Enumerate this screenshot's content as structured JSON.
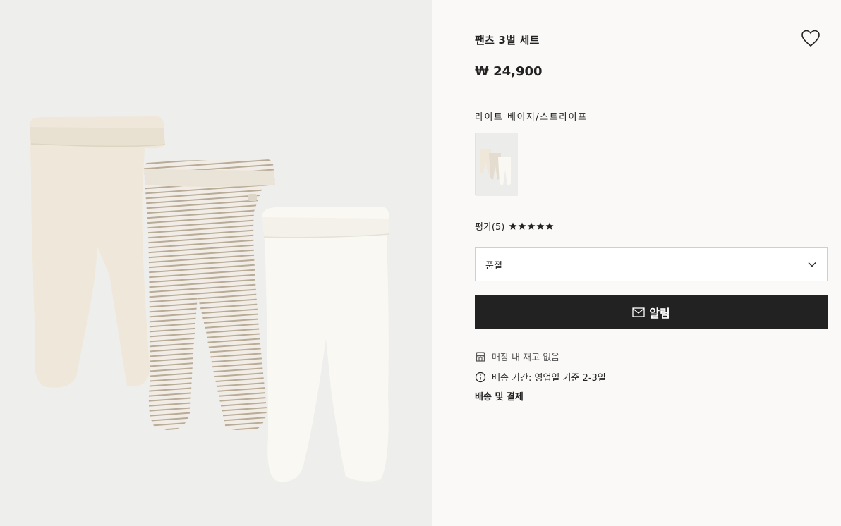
{
  "product": {
    "title": "팬츠 3벌 세트",
    "price": "₩ 24,900",
    "color_name": "라이트 베이지/스트라이프",
    "rating_label": "평가(5)",
    "rating_stars": 5
  },
  "size_select": {
    "selected": "품절"
  },
  "actions": {
    "notify_label": "알림"
  },
  "availability": {
    "store_stock": "매장 내 재고 없음",
    "delivery_time": "배송 기간: 영업일 기준 2-3일",
    "shipping_payment_link": "배송 및 결제"
  },
  "icons": {
    "wishlist": "heart-icon",
    "dropdown": "chevron-down-icon",
    "notify": "mail-icon",
    "store": "store-icon",
    "info": "info-icon",
    "rating": "star-icon"
  },
  "colors": {
    "page_bg": "#faf9f8",
    "image_bg": "#eeeeed",
    "button_bg": "#222222",
    "text": "#222222"
  }
}
